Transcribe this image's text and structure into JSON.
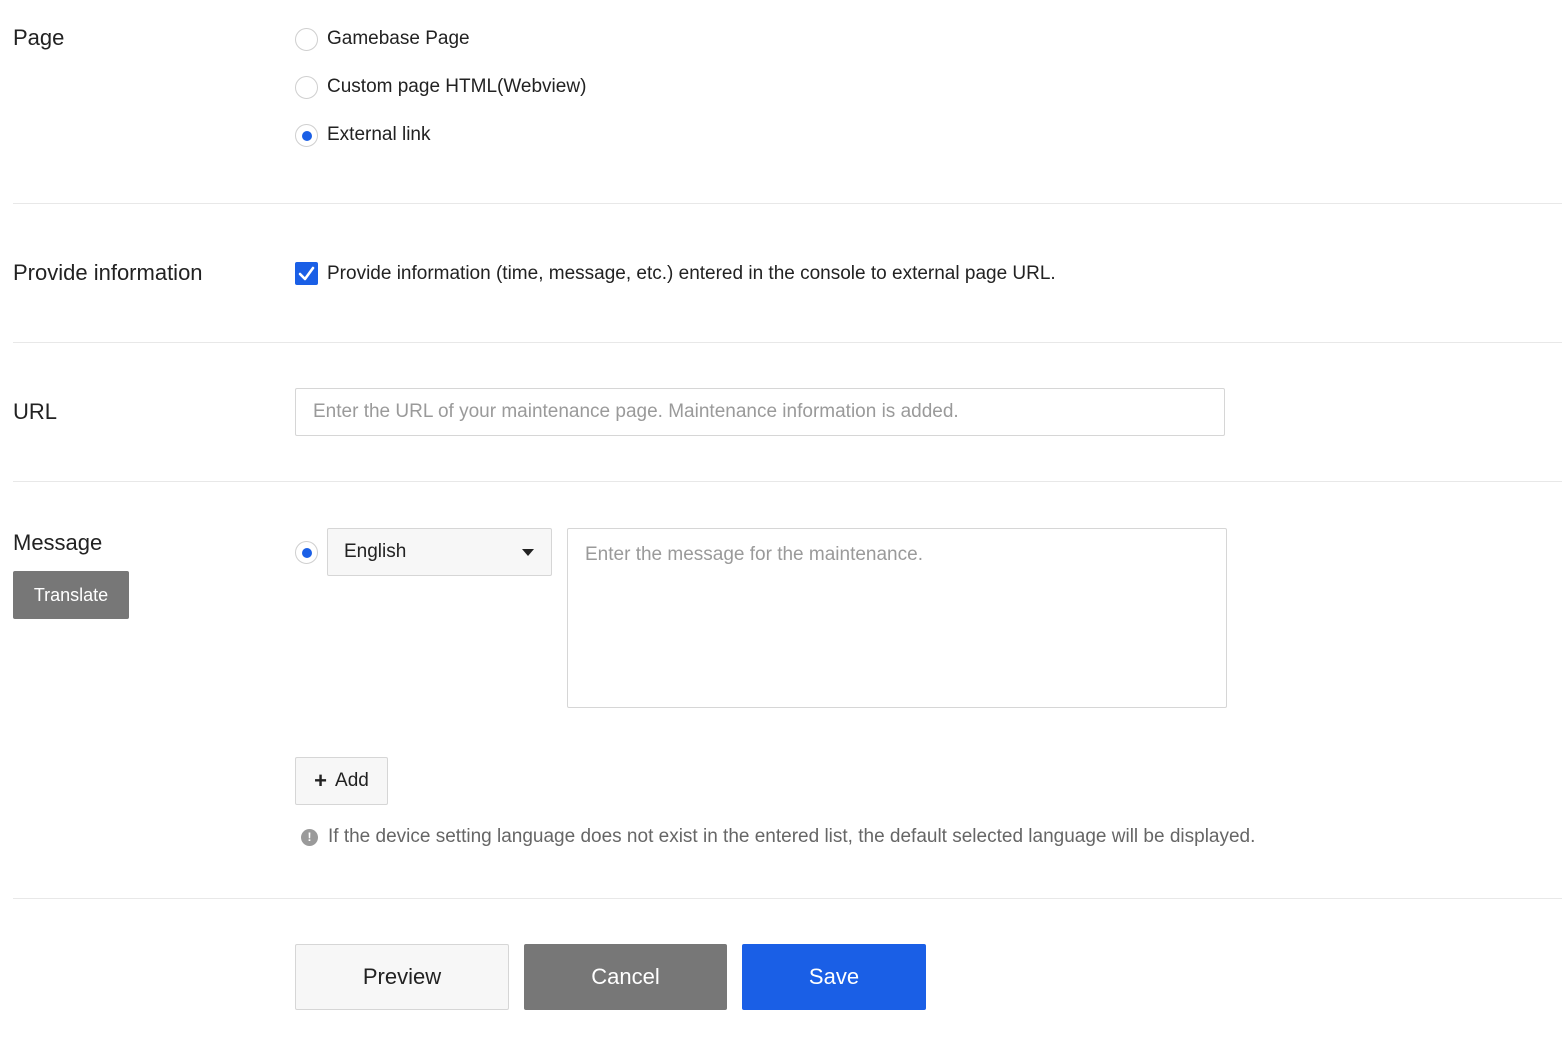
{
  "page_section": {
    "label": "Page",
    "options": [
      {
        "label": "Gamebase Page",
        "selected": false
      },
      {
        "label": "Custom page HTML(Webview)",
        "selected": false
      },
      {
        "label": "External link",
        "selected": true
      }
    ]
  },
  "provide_info_section": {
    "label": "Provide information",
    "checkbox_label": "Provide information (time, message, etc.) entered in the console to external page URL.",
    "checked": true
  },
  "url_section": {
    "label": "URL",
    "value": "",
    "placeholder": "Enter the URL of your maintenance page. Maintenance information is added."
  },
  "message_section": {
    "label": "Message",
    "translate_label": "Translate",
    "default_language_selected": true,
    "language": "English",
    "message_value": "",
    "message_placeholder": "Enter the message for the maintenance.",
    "add_label": "Add",
    "notice": "If the device setting language does not exist in the entered list, the default selected language will be displayed."
  },
  "actions": {
    "preview_label": "Preview",
    "cancel_label": "Cancel",
    "save_label": "Save"
  },
  "colors": {
    "accent": "#1a5fe6",
    "secondary_button": "#777777",
    "border": "#d6d6d6"
  }
}
